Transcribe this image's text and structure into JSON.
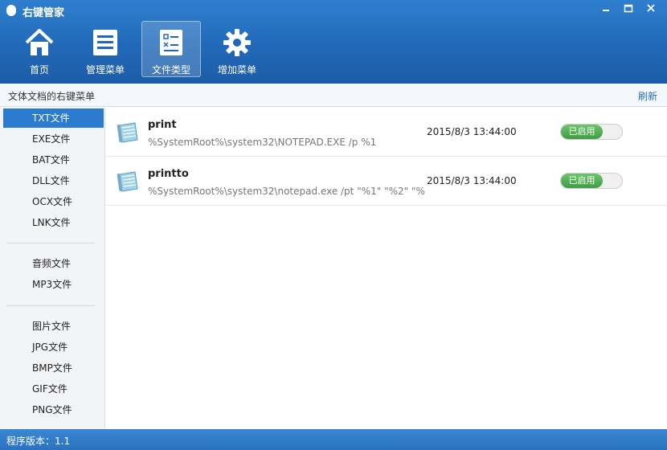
{
  "window": {
    "title": "右键管家",
    "controls": [
      "minimize-icon",
      "restore-icon",
      "close-icon"
    ]
  },
  "toolbar": {
    "items": [
      {
        "label": "首页",
        "icon": "home-icon",
        "active": false
      },
      {
        "label": "管理菜单",
        "icon": "menu-list-icon",
        "active": false
      },
      {
        "label": "文件类型",
        "icon": "file-type-icon",
        "active": true
      },
      {
        "label": "增加菜单",
        "icon": "gear-icon",
        "active": false
      }
    ]
  },
  "subheader": {
    "title": "文体文档的右键菜单",
    "refresh": "刷新"
  },
  "sidebar": {
    "groups": [
      [
        {
          "label": "TXT文件",
          "active": true
        },
        {
          "label": "EXE文件"
        },
        {
          "label": "BAT文件"
        },
        {
          "label": "DLL文件"
        },
        {
          "label": "OCX文件"
        },
        {
          "label": "LNK文件"
        }
      ],
      [
        {
          "label": "音频文件"
        },
        {
          "label": "MP3文件"
        }
      ],
      [
        {
          "label": "图片文件"
        },
        {
          "label": "JPG文件"
        },
        {
          "label": "BMP文件"
        },
        {
          "label": "GIF文件"
        },
        {
          "label": "PNG文件"
        }
      ]
    ]
  },
  "entries": [
    {
      "name": "print",
      "command": "%SystemRoot%\\system32\\NOTEPAD.EXE /p %1",
      "time": "2015/8/3 13:44:00",
      "status": "已启用"
    },
    {
      "name": "printto",
      "command": "%SystemRoot%\\system32\\notepad.exe /pt \"%1\" \"%2\" \"%...",
      "time": "2015/8/3 13:44:00",
      "status": "已启用"
    }
  ],
  "statusbar": {
    "version": "程序版本：1.1"
  },
  "colors": {
    "header_blue": "#2169b8",
    "accent_blue": "#2b7cd0",
    "toggle_green": "#4caf50"
  }
}
